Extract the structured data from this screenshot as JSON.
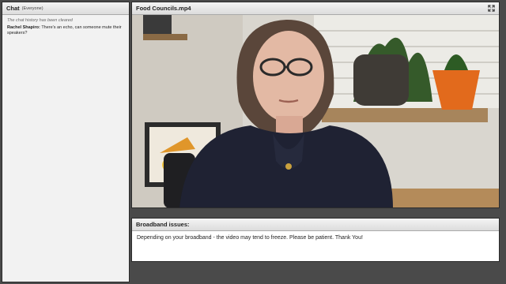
{
  "chat": {
    "title": "Chat",
    "scope": "(Everyone)",
    "notice": "The chat history has been cleared",
    "messages": [
      {
        "sender": "Rachel Shapiro:",
        "text": "There's an echo, can someone mute their speakers?"
      }
    ]
  },
  "video": {
    "title": "Food Councils.mp4",
    "fullscreen_icon": "expand-arrows-icon"
  },
  "notes": {
    "title": "Broadband issues:",
    "text": "Depending on your broadband - the video may tend to freeze. Please be patient.  Thank You!"
  }
}
